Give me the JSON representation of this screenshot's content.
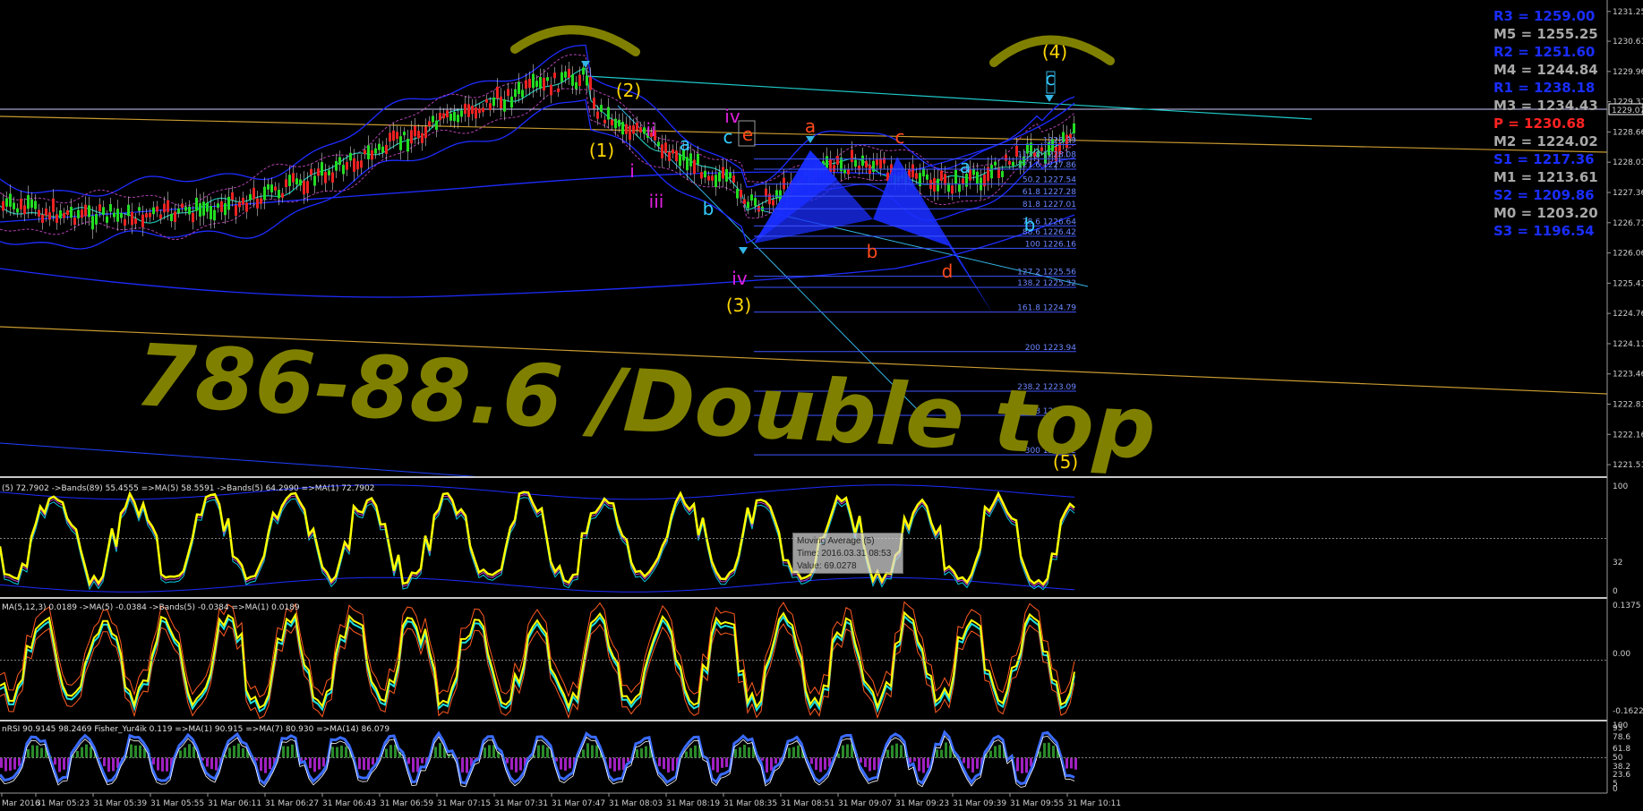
{
  "chart_data": [
    {
      "type": "candlestick",
      "name": "main",
      "y_ticks": [
        "1231.25",
        "1230.61",
        "1229.96",
        "1229.31",
        "1228.66",
        "1228.01",
        "1227.36",
        "1226.71",
        "1226.06",
        "1225.41",
        "1224.76",
        "1224.11",
        "1223.46",
        "1222.81",
        "1222.16",
        "1221.51"
      ],
      "ylim": [
        1221.3,
        1231.4
      ],
      "current_price": "1229.07",
      "pivots": [
        {
          "label": "R3 = 1259.00",
          "color": "#1a2dff"
        },
        {
          "label": "M5 = 1255.25",
          "color": "#a8a8a8"
        },
        {
          "label": "R2 = 1251.60",
          "color": "#1a2dff"
        },
        {
          "label": "M4 = 1244.84",
          "color": "#a8a8a8"
        },
        {
          "label": "R1 = 1238.18",
          "color": "#1a2dff"
        },
        {
          "label": "M3 = 1234.43",
          "color": "#a8a8a8"
        },
        {
          "label": "P  = 1230.68",
          "color": "#ff2222"
        },
        {
          "label": "M2 = 1224.02",
          "color": "#a8a8a8"
        },
        {
          "label": "S1 = 1217.36",
          "color": "#1a2dff"
        },
        {
          "label": "M1 = 1213.61",
          "color": "#a8a8a8"
        },
        {
          "label": "S2 = 1209.86",
          "color": "#1a2dff"
        },
        {
          "label": "M0 = 1203.20",
          "color": "#a8a8a8"
        },
        {
          "label": "S3 = 1196.54",
          "color": "#1a2dff"
        }
      ],
      "fib_levels": [
        {
          "label": "1228.39",
          "value": 1228.39
        },
        {
          "label": "113.8 1228.08",
          "value": 1228.08
        },
        {
          "label": "121.6 1227.86",
          "value": 1227.86
        },
        {
          "label": "50.2 1227.54",
          "value": 1227.54
        },
        {
          "label": "61.8 1227.28",
          "value": 1227.28
        },
        {
          "label": "81.8 1227.01",
          "value": 1227.01
        },
        {
          "label": "78.6 1226.64",
          "value": 1226.64
        },
        {
          "label": "88.6 1226.42",
          "value": 1226.42
        },
        {
          "label": "100 1226.16",
          "value": 1226.16
        },
        {
          "label": "127.2 1225.56",
          "value": 1225.56
        },
        {
          "label": "138.2 1225.32",
          "value": 1225.32
        },
        {
          "label": "161.8 1224.79",
          "value": 1224.79
        },
        {
          "label": "200 1223.94",
          "value": 1223.94
        },
        {
          "label": "238.2 1223.09",
          "value": 1223.09
        },
        {
          "label": "261.8 1222.57",
          "value": 1222.57
        },
        {
          "label": "300 1221.72",
          "value": 1221.72
        }
      ],
      "wave_labels": [
        {
          "text": "(1)",
          "color": "#ffd700"
        },
        {
          "text": "(2)",
          "color": "#ffd700"
        },
        {
          "text": "(3)",
          "color": "#ffd700"
        },
        {
          "text": "(4)",
          "color": "#ffd700"
        },
        {
          "text": "(5)",
          "color": "#ffd700"
        },
        {
          "text": "i",
          "color": "#e020e0"
        },
        {
          "text": "ii",
          "color": "#e020e0"
        },
        {
          "text": "iii",
          "color": "#e020e0"
        },
        {
          "text": "iv",
          "color": "#e020e0"
        },
        {
          "text": "iv",
          "color": "#e020e0"
        },
        {
          "text": "a",
          "color": "#33ccff"
        },
        {
          "text": "b",
          "color": "#33ccff"
        },
        {
          "text": "c",
          "color": "#33ccff"
        },
        {
          "text": "a",
          "color": "#33ccff"
        },
        {
          "text": "b",
          "color": "#33ccff"
        },
        {
          "text": "c",
          "color": "#33ccff"
        },
        {
          "text": "e",
          "color": "#ff4a1a"
        },
        {
          "text": "a",
          "color": "#ff4a1a"
        },
        {
          "text": "b",
          "color": "#ff4a1a"
        },
        {
          "text": "c",
          "color": "#ff4a1a"
        },
        {
          "text": "d",
          "color": "#ff4a1a"
        }
      ],
      "handwriting": {
        "text": "786-88.6 /Double top",
        "color": "#808000"
      }
    },
    {
      "type": "line",
      "name": "oscillator-1",
      "label": "(5) 72.7902  ->Bands(89) 55.4555  =>MA(5) 58.5591  ->Bands(5) 64.2990  =>MA(1) 72.7902",
      "y_ticks": [
        "100",
        "32",
        "0"
      ]
    },
    {
      "type": "line",
      "name": "oscillator-2",
      "label": "MA(5,12,3) 0.0189  ->MA(5) -0.0384  ->Bands(5) -0.0384  =>MA(1) 0.0189",
      "y_ticks": [
        "0.1375",
        "0.00",
        "-0.1622"
      ]
    },
    {
      "type": "line",
      "name": "oscillator-3",
      "label": "nRSI 90.9145 98.2469  Fisher_Yur4ik 0.119  =>MA(1) 90.915  =>MA(7) 80.930  =>MA(14) 86.079",
      "y_ticks": [
        "100",
        "95",
        "78.6",
        "61.8",
        "50",
        "38.2",
        "23.6",
        "5",
        "0"
      ]
    }
  ],
  "x_axis_ticks": [
    "Mar 2016",
    "31 Mar 05:23",
    "31 Mar 05:39",
    "31 Mar 05:55",
    "31 Mar 06:11",
    "31 Mar 06:27",
    "31 Mar 06:43",
    "31 Mar 06:59",
    "31 Mar 07:15",
    "31 Mar 07:31",
    "31 Mar 07:47",
    "31 Mar 08:03",
    "31 Mar 08:19",
    "31 Mar 08:35",
    "31 Mar 08:51",
    "31 Mar 09:07",
    "31 Mar 09:23",
    "31 Mar 09:39",
    "31 Mar 09:55",
    "31 Mar 10:11"
  ],
  "tooltip": {
    "line1": "Moving Average (5)",
    "line2": "Time: 2016.03.31 08:53",
    "line3": "Value: 69.0278"
  }
}
